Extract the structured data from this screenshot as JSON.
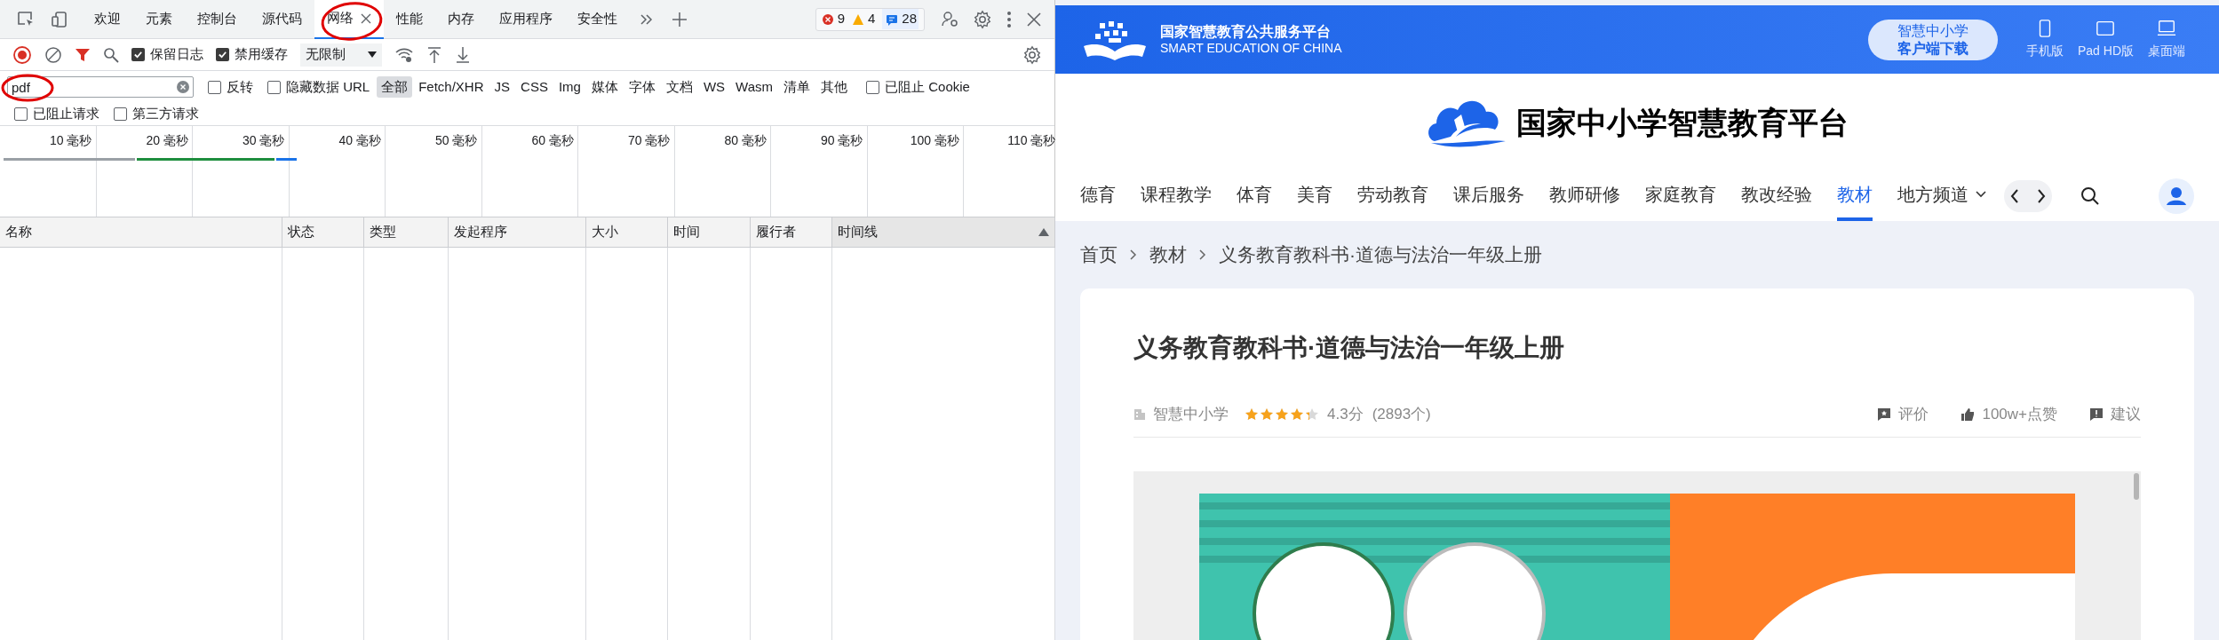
{
  "devtools": {
    "tabs": [
      {
        "label": "欢迎",
        "selected": false
      },
      {
        "label": "元素",
        "selected": false
      },
      {
        "label": "控制台",
        "selected": false
      },
      {
        "label": "源代码",
        "selected": false
      },
      {
        "label": "网络",
        "selected": true
      },
      {
        "label": "性能",
        "selected": false
      },
      {
        "label": "内存",
        "selected": false
      },
      {
        "label": "应用程序",
        "selected": false
      },
      {
        "label": "安全性",
        "selected": false
      }
    ],
    "issue_counts": [
      {
        "kind": "error",
        "count": "9"
      },
      {
        "kind": "warning",
        "count": "4"
      },
      {
        "kind": "info",
        "count": "28"
      }
    ],
    "toolbar": {
      "checkboxes": [
        {
          "label": "保留日志",
          "checked": true
        },
        {
          "label": "禁用缓存",
          "checked": true
        }
      ],
      "throttling": "无限制"
    },
    "filter": {
      "value": "pdf",
      "checkboxes_before": [
        {
          "label": "反转",
          "checked": false
        },
        {
          "label": "隐藏数据 URL",
          "checked": false
        }
      ],
      "types": [
        {
          "label": "全部",
          "selected": true
        },
        {
          "label": "Fetch/XHR",
          "selected": false
        },
        {
          "label": "JS",
          "selected": false
        },
        {
          "label": "CSS",
          "selected": false
        },
        {
          "label": "Img",
          "selected": false
        },
        {
          "label": "媒体",
          "selected": false
        },
        {
          "label": "字体",
          "selected": false
        },
        {
          "label": "文档",
          "selected": false
        },
        {
          "label": "WS",
          "selected": false
        },
        {
          "label": "Wasm",
          "selected": false
        },
        {
          "label": "清单",
          "selected": false
        },
        {
          "label": "其他",
          "selected": false
        }
      ],
      "checkboxes_after": [
        {
          "label": "已阻止 Cookie",
          "checked": false
        }
      ],
      "second_row": [
        {
          "label": "已阻止请求",
          "checked": false
        },
        {
          "label": "第三方请求",
          "checked": false
        }
      ]
    },
    "overview": {
      "ticks": [
        "10 毫秒",
        "20 毫秒",
        "30 毫秒",
        "40 毫秒",
        "50 毫秒",
        "60 毫秒",
        "70 毫秒",
        "80 毫秒",
        "90 毫秒",
        "100 毫秒",
        "110 毫秒"
      ]
    },
    "table": {
      "columns": [
        {
          "label": "名称",
          "sorted": false
        },
        {
          "label": "状态",
          "sorted": false
        },
        {
          "label": "类型",
          "sorted": false
        },
        {
          "label": "发起程序",
          "sorted": false
        },
        {
          "label": "大小",
          "sorted": false
        },
        {
          "label": "时间",
          "sorted": false
        },
        {
          "label": "履行者",
          "sorted": false
        },
        {
          "label": "时间线",
          "sorted": true
        }
      ]
    }
  },
  "site": {
    "header": {
      "brand_title": "国家智慧教育公共服务平台",
      "brand_subtitle": "SMART EDUCATION OF CHINA",
      "download_button": {
        "line_1": "智慧中小学",
        "line_2": "客户端下载"
      },
      "devices": [
        {
          "kind": "phone",
          "label": "手机版"
        },
        {
          "kind": "tablet",
          "label": "Pad HD版"
        },
        {
          "kind": "desktop",
          "label": "桌面端"
        }
      ]
    },
    "logo_title": "国家中小学智慧教育平台",
    "nav": [
      {
        "label": "德育",
        "selected": false,
        "kind": "link"
      },
      {
        "label": "课程教学",
        "selected": false,
        "kind": "link"
      },
      {
        "label": "体育",
        "selected": false,
        "kind": "link"
      },
      {
        "label": "美育",
        "selected": false,
        "kind": "link"
      },
      {
        "label": "劳动教育",
        "selected": false,
        "kind": "link"
      },
      {
        "label": "课后服务",
        "selected": false,
        "kind": "link"
      },
      {
        "label": "教师研修",
        "selected": false,
        "kind": "link"
      },
      {
        "label": "家庭教育",
        "selected": false,
        "kind": "link"
      },
      {
        "label": "教改经验",
        "selected": false,
        "kind": "link"
      },
      {
        "label": "教材",
        "selected": true,
        "kind": "link"
      },
      {
        "label": "地方频道",
        "selected": false,
        "kind": "dropdown"
      }
    ],
    "breadcrumb": [
      "首页",
      "教材",
      "义务教育教科书·道德与法治一年级上册"
    ],
    "resource": {
      "title": "义务教育教科书·道德与法治一年级上册",
      "publisher": "智慧中小学",
      "stars": 4.3,
      "score": "4.3分",
      "count": "(2893个)",
      "actions": [
        {
          "kind": "comment",
          "label": "评价"
        },
        {
          "kind": "like",
          "label": "100w+点赞"
        },
        {
          "kind": "suggest",
          "label": "建议"
        }
      ]
    }
  }
}
